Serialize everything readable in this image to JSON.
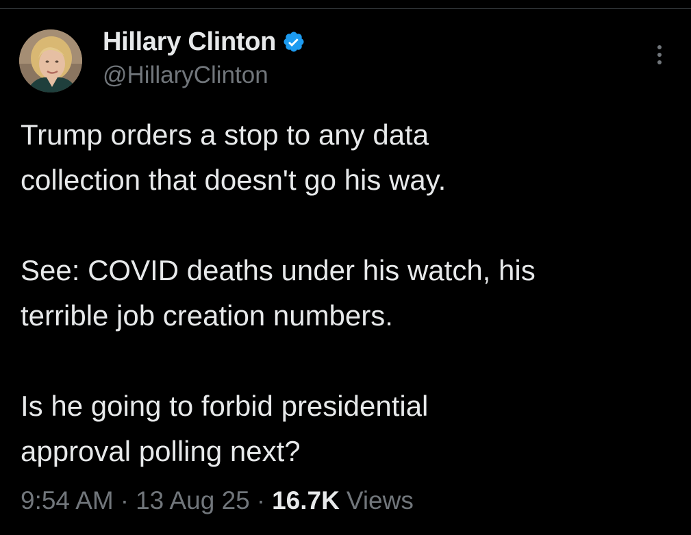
{
  "tweet": {
    "author": {
      "display_name": "Hillary Clinton",
      "handle": "@HillaryClinton",
      "verified_icon": "verified-badge-icon",
      "verified_color": "#1d9bf0"
    },
    "more_icon": "more-options-icon",
    "paragraphs": [
      {
        "lines": [
          "Trump orders a stop to any data",
          "collection that doesn't go his way."
        ]
      },
      {
        "lines": [
          "See: COVID deaths under his watch, his",
          "terrible job creation numbers."
        ]
      },
      {
        "lines": [
          "Is he going to forbid presidential",
          "approval polling next?"
        ]
      }
    ],
    "meta": {
      "time": "9:54 AM",
      "separator": "·",
      "date": "13 Aug 25",
      "views_count": "16.7K",
      "views_label": "Views"
    }
  },
  "colors": {
    "background": "#000000",
    "primary_text": "#e7e9ea",
    "secondary_text": "#71767b",
    "divider": "#2f3336",
    "accent": "#1d9bf0"
  }
}
